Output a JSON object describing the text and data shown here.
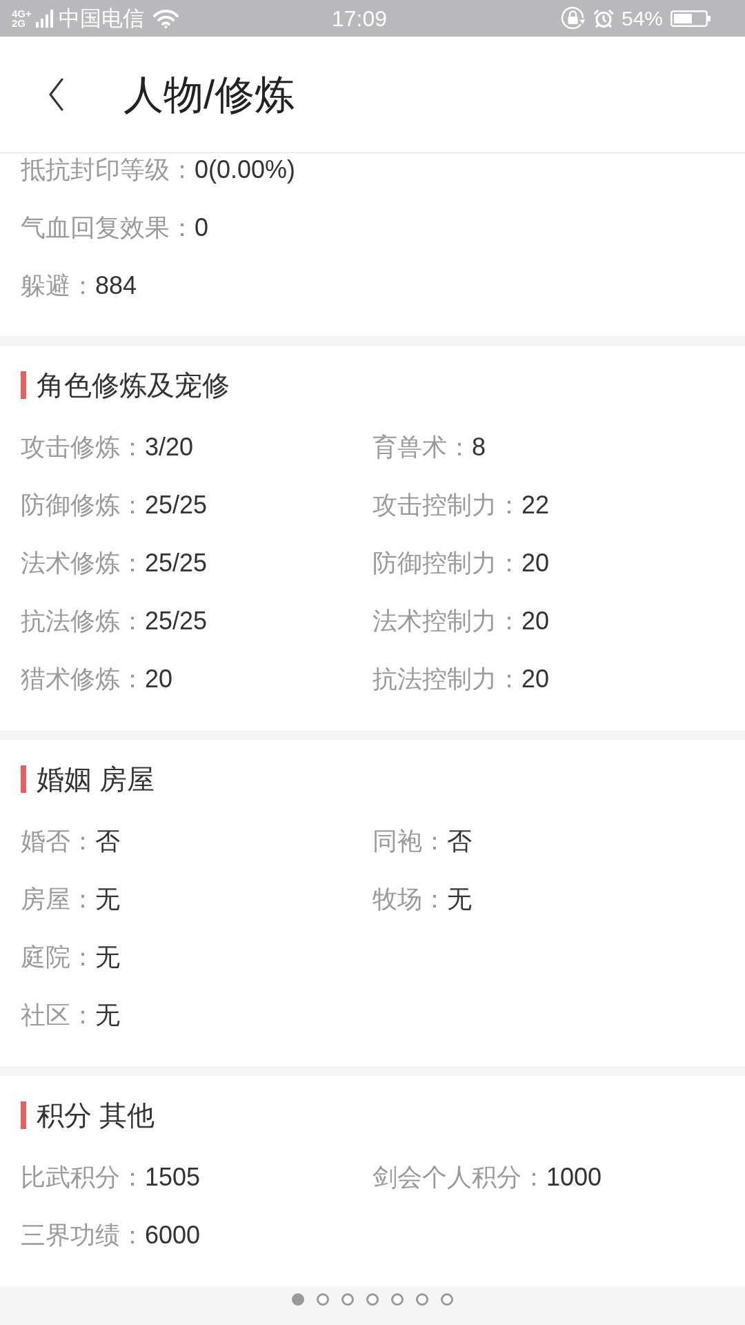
{
  "status_bar": {
    "network": [
      "4G+",
      "2G"
    ],
    "carrier": "中国电信",
    "time": "17:09",
    "battery": "54%"
  },
  "nav": {
    "title": "人物/修炼"
  },
  "sections": [
    {
      "rows": [
        [
          {
            "label": "抵抗封印等级：",
            "value": "0(0.00%)"
          }
        ],
        [
          {
            "label": "气血回复效果：",
            "value": "0"
          }
        ],
        [
          {
            "label": "躲避：",
            "value": "884"
          }
        ]
      ]
    },
    {
      "title": "角色修炼及宠修",
      "rows": [
        [
          {
            "label": "攻击修炼：",
            "value": "3/20"
          },
          {
            "label": "育兽术：",
            "value": "8"
          }
        ],
        [
          {
            "label": "防御修炼：",
            "value": "25/25"
          },
          {
            "label": "攻击控制力：",
            "value": "22"
          }
        ],
        [
          {
            "label": "法术修炼：",
            "value": "25/25"
          },
          {
            "label": "防御控制力：",
            "value": "20"
          }
        ],
        [
          {
            "label": "抗法修炼：",
            "value": "25/25"
          },
          {
            "label": "法术控制力：",
            "value": "20"
          }
        ],
        [
          {
            "label": "猎术修炼：",
            "value": "20"
          },
          {
            "label": "抗法控制力：",
            "value": "20"
          }
        ]
      ]
    },
    {
      "title": "婚姻 房屋",
      "rows": [
        [
          {
            "label": "婚否：",
            "value": "否"
          },
          {
            "label": "同袍：",
            "value": "否"
          }
        ],
        [
          {
            "label": "房屋：",
            "value": "无"
          },
          {
            "label": "牧场：",
            "value": "无"
          }
        ],
        [
          {
            "label": "庭院：",
            "value": "无"
          }
        ],
        [
          {
            "label": "社区：",
            "value": "无"
          }
        ]
      ]
    },
    {
      "title": "积分 其他",
      "rows": [
        [
          {
            "label": "比武积分：",
            "value": "1505"
          },
          {
            "label": "剑会个人积分：",
            "value": "1000"
          }
        ],
        [
          {
            "label": "三界功绩：",
            "value": "6000"
          }
        ]
      ]
    }
  ],
  "pager": {
    "pages": [
      {
        "selected": true
      },
      {
        "selected": false
      },
      {
        "selected": false
      },
      {
        "selected": false
      },
      {
        "selected": false
      },
      {
        "selected": false
      },
      {
        "selected": false
      }
    ]
  }
}
